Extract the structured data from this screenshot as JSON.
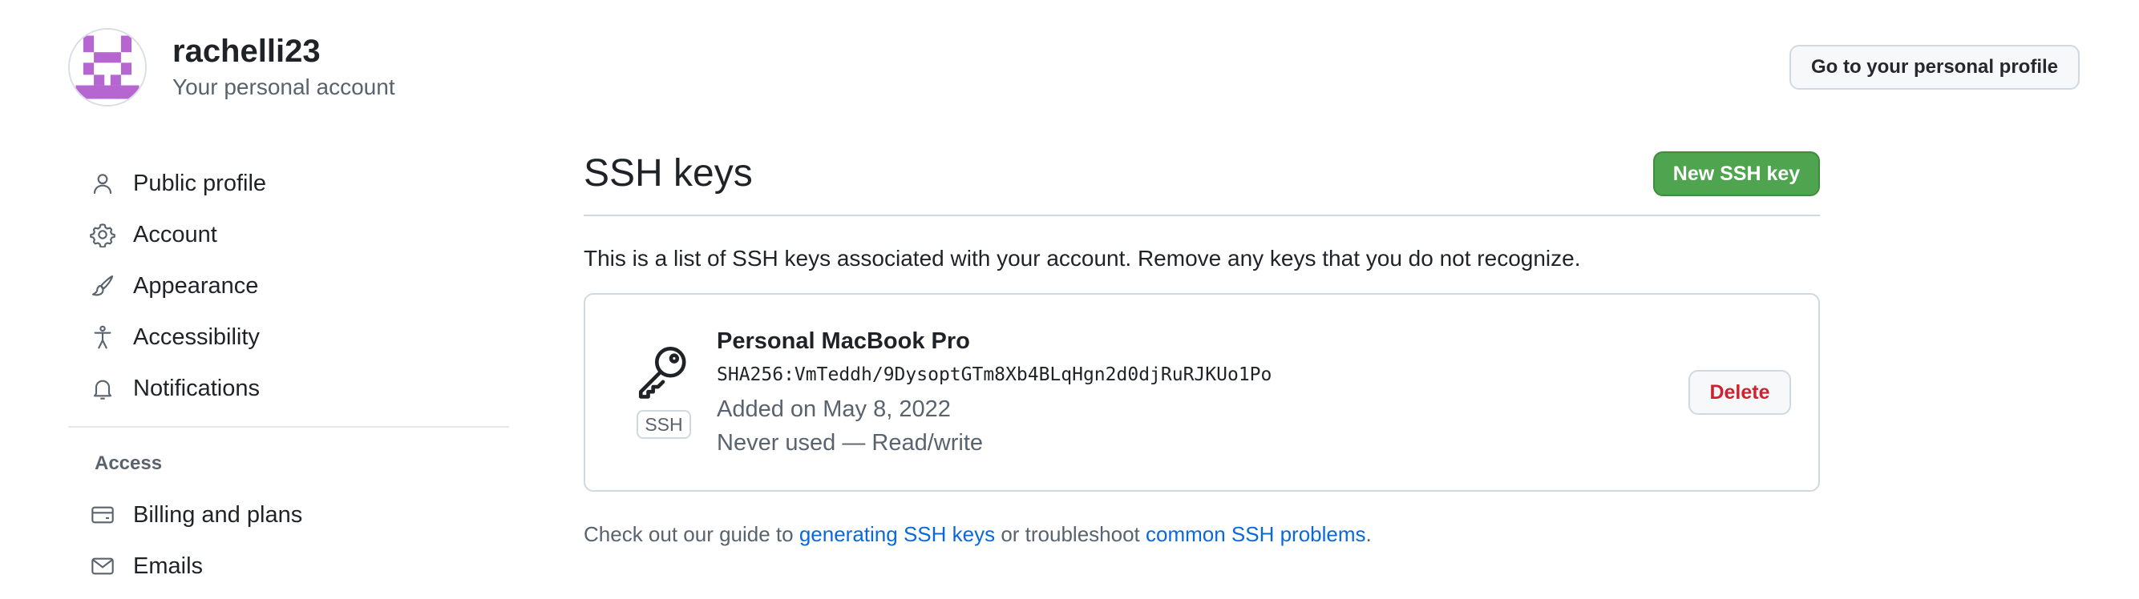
{
  "header": {
    "username": "rachelli23",
    "subtitle": "Your personal account",
    "profile_button": "Go to your personal profile"
  },
  "sidebar": {
    "items": [
      {
        "label": "Public profile",
        "icon": "person-icon"
      },
      {
        "label": "Account",
        "icon": "gear-icon"
      },
      {
        "label": "Appearance",
        "icon": "paintbrush-icon"
      },
      {
        "label": "Accessibility",
        "icon": "accessibility-icon"
      },
      {
        "label": "Notifications",
        "icon": "bell-icon"
      }
    ],
    "access_heading": "Access",
    "access_items": [
      {
        "label": "Billing and plans",
        "icon": "credit-card-icon"
      },
      {
        "label": "Emails",
        "icon": "mail-icon"
      }
    ]
  },
  "main": {
    "title": "SSH keys",
    "new_key_button": "New SSH key",
    "intro": "This is a list of SSH keys associated with your account. Remove any keys that you do not recognize.",
    "key": {
      "title": "Personal MacBook Pro",
      "fingerprint": "SHA256:VmTeddh/9DysoptGTm8Xb4BLqHgn2d0djRuRJKUo1Po",
      "added": "Added on May 8, 2022",
      "usage": "Never used — Read/write",
      "badge": "SSH",
      "delete_button": "Delete",
      "icon": "key-icon"
    },
    "footer": {
      "prefix": "Check out our guide to ",
      "link1": "generating SSH keys",
      "middle": " or troubleshoot ",
      "link2": "common SSH problems",
      "suffix": "."
    }
  },
  "colors": {
    "primary_button": "#4fa54f",
    "danger_text": "#cf222e",
    "link": "#0969da",
    "avatar_identicon": "#b566d0"
  }
}
